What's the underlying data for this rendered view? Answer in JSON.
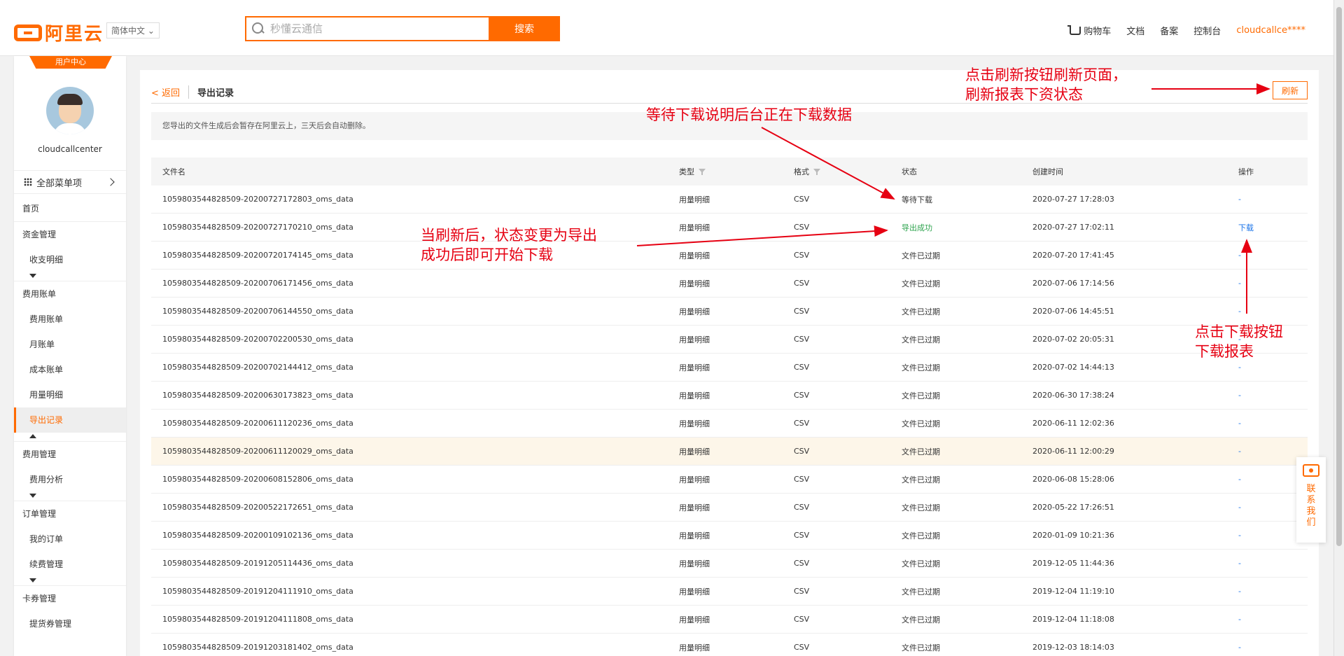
{
  "topbar": {
    "brand": "阿里云",
    "language": "简体中文",
    "search_placeholder": "秒懂云通信",
    "search_button": "搜索",
    "nav": [
      "购物车",
      "文档",
      "备案",
      "控制台"
    ],
    "username": "cloudcallce****"
  },
  "sidebar": {
    "tag": "用户中心",
    "username": "cloudcallcenter",
    "all_menu": "全部菜单项",
    "items": {
      "home": "首页",
      "funds": "资金管理",
      "income_expense": "收支明细",
      "billing": "费用账单",
      "bill": "费用账单",
      "monthly": "月账单",
      "cost": "成本账单",
      "usage": "用量明细",
      "export": "导出记录",
      "cost_mgmt": "费用管理",
      "cost_analysis": "费用分析",
      "orders": "订单管理",
      "my_orders": "我的订单",
      "renewal": "续费管理",
      "vouchers": "卡券管理",
      "pickup": "提货券管理"
    }
  },
  "main": {
    "back": "< 返回",
    "title": "导出记录",
    "refresh": "刷新",
    "notice": "您导出的文件生成后会暂存在阿里云上，三天后会自动删除。",
    "columns": {
      "name": "文件名",
      "type": "类型",
      "format": "格式",
      "status": "状态",
      "time": "创建时间",
      "op": "操作"
    },
    "rows": [
      {
        "name": "1059803544828509-20200727172803_oms_data",
        "type": "用量明细",
        "format": "CSV",
        "status": "等待下载",
        "time": "2020-07-27 17:28:03",
        "op": "-"
      },
      {
        "name": "1059803544828509-20200727170210_oms_data",
        "type": "用量明细",
        "format": "CSV",
        "status": "导出成功",
        "time": "2020-07-27 17:02:11",
        "op": "下载"
      },
      {
        "name": "1059803544828509-20200720174145_oms_data",
        "type": "用量明细",
        "format": "CSV",
        "status": "文件已过期",
        "time": "2020-07-20 17:41:45",
        "op": "-"
      },
      {
        "name": "1059803544828509-20200706171456_oms_data",
        "type": "用量明细",
        "format": "CSV",
        "status": "文件已过期",
        "time": "2020-07-06 17:14:56",
        "op": "-"
      },
      {
        "name": "1059803544828509-20200706144550_oms_data",
        "type": "用量明细",
        "format": "CSV",
        "status": "文件已过期",
        "time": "2020-07-06 14:45:51",
        "op": "-"
      },
      {
        "name": "1059803544828509-20200702200530_oms_data",
        "type": "用量明细",
        "format": "CSV",
        "status": "文件已过期",
        "time": "2020-07-02 20:05:31",
        "op": "-"
      },
      {
        "name": "1059803544828509-20200702144412_oms_data",
        "type": "用量明细",
        "format": "CSV",
        "status": "文件已过期",
        "time": "2020-07-02 14:44:13",
        "op": "-"
      },
      {
        "name": "1059803544828509-20200630173823_oms_data",
        "type": "用量明细",
        "format": "CSV",
        "status": "文件已过期",
        "time": "2020-06-30 17:38:24",
        "op": "-"
      },
      {
        "name": "1059803544828509-20200611120236_oms_data",
        "type": "用量明细",
        "format": "CSV",
        "status": "文件已过期",
        "time": "2020-06-11 12:02:36",
        "op": "-"
      },
      {
        "name": "1059803544828509-20200611120029_oms_data",
        "type": "用量明细",
        "format": "CSV",
        "status": "文件已过期",
        "time": "2020-06-11 12:00:29",
        "op": "-"
      },
      {
        "name": "1059803544828509-20200608152806_oms_data",
        "type": "用量明细",
        "format": "CSV",
        "status": "文件已过期",
        "time": "2020-06-08 15:28:06",
        "op": "-"
      },
      {
        "name": "1059803544828509-20200522172651_oms_data",
        "type": "用量明细",
        "format": "CSV",
        "status": "文件已过期",
        "time": "2020-05-22 17:26:51",
        "op": "-"
      },
      {
        "name": "1059803544828509-20200109102136_oms_data",
        "type": "用量明细",
        "format": "CSV",
        "status": "文件已过期",
        "time": "2020-01-09 10:21:36",
        "op": "-"
      },
      {
        "name": "1059803544828509-20191205114436_oms_data",
        "type": "用量明细",
        "format": "CSV",
        "status": "文件已过期",
        "time": "2019-12-05 11:44:36",
        "op": "-"
      },
      {
        "name": "1059803544828509-20191204111910_oms_data",
        "type": "用量明细",
        "format": "CSV",
        "status": "文件已过期",
        "time": "2019-12-04 11:19:10",
        "op": "-"
      },
      {
        "name": "1059803544828509-20191204111808_oms_data",
        "type": "用量明细",
        "format": "CSV",
        "status": "文件已过期",
        "time": "2019-12-04 11:18:08",
        "op": "-"
      },
      {
        "name": "1059803544828509-20191203181402_oms_data",
        "type": "用量明细",
        "format": "CSV",
        "status": "文件已过期",
        "time": "2019-12-03 18:14:03",
        "op": "-"
      }
    ]
  },
  "annotations": {
    "refresh_line1": "点击刷新按钮刷新页面，",
    "refresh_line2": "刷新报表下资状态",
    "waiting": "等待下载说明后台正在下载数据",
    "success_line1": "当刷新后，状态变更为导出",
    "success_line2": "成功后即可开始下载",
    "download_line1": "点击下载按钮",
    "download_line2": "下载报表"
  },
  "contact": "联系我们",
  "colors": {
    "accent": "#ff6a00",
    "annotation": "#e60012",
    "success": "#2fa44f",
    "link": "#1a73e8"
  }
}
